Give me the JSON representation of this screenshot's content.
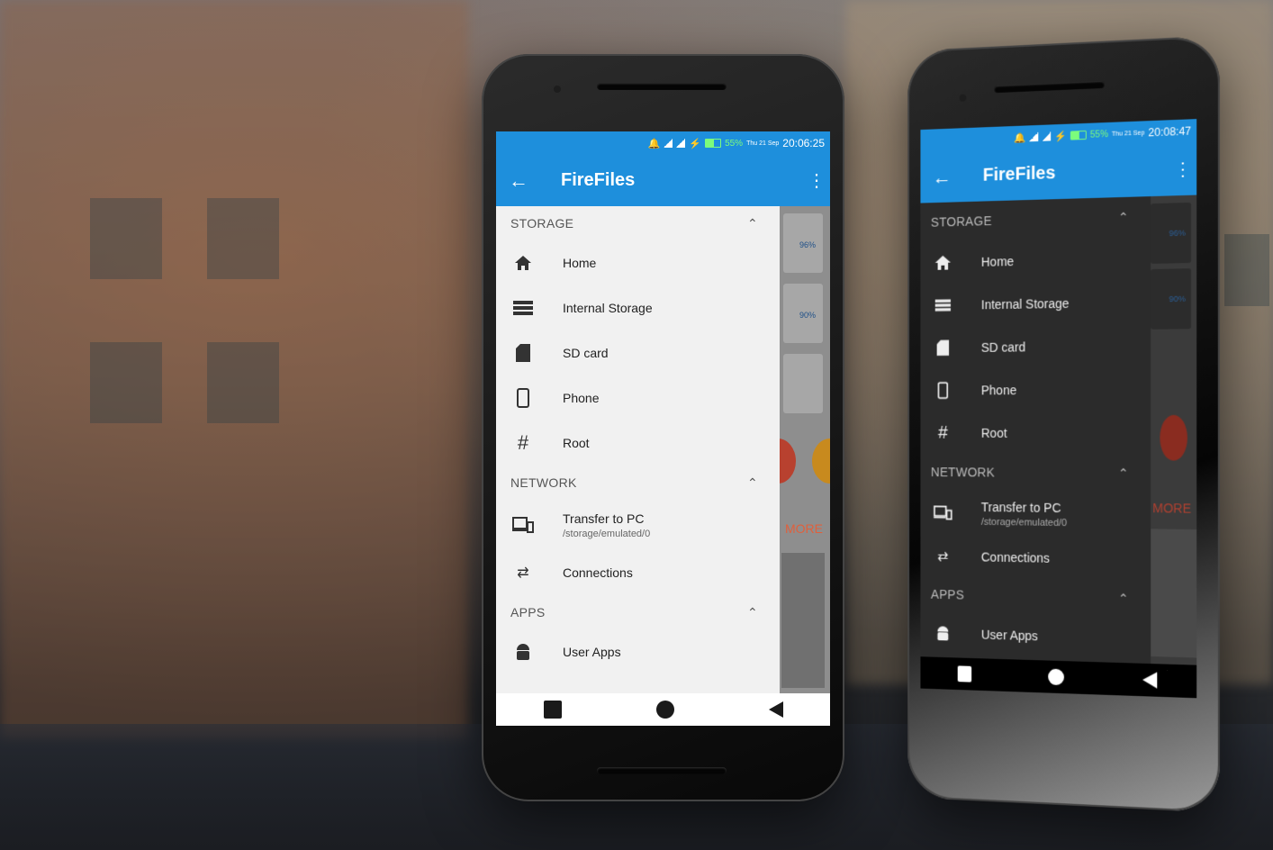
{
  "phones": [
    {
      "theme": "light",
      "status": {
        "battery": "55%",
        "date": "Thu 21 Sep",
        "time": "20:06:25"
      },
      "app_title": "FireFiles",
      "underlay": {
        "card1_pct": "96%",
        "card2_pct": "90%",
        "more_label": "MORE"
      },
      "sections": [
        {
          "title": "STORAGE",
          "items": [
            {
              "icon": "home-icon",
              "label": "Home"
            },
            {
              "icon": "storage-icon",
              "label": "Internal Storage"
            },
            {
              "icon": "sd-card-icon",
              "label": "SD card"
            },
            {
              "icon": "phone-icon",
              "label": "Phone"
            },
            {
              "icon": "hash-icon",
              "label": "Root"
            }
          ]
        },
        {
          "title": "NETWORK",
          "items": [
            {
              "icon": "devices-icon",
              "label": "Transfer to PC",
              "sub": "/storage/emulated/0"
            },
            {
              "icon": "connections-icon",
              "label": "Connections"
            }
          ]
        },
        {
          "title": "APPS",
          "items": [
            {
              "icon": "android-icon",
              "label": "User Apps"
            }
          ]
        }
      ]
    },
    {
      "theme": "dark",
      "status": {
        "battery": "55%",
        "date": "Thu 21 Sep",
        "time": "20:08:47"
      },
      "app_title": "FireFiles",
      "underlay": {
        "card1_pct": "96%",
        "card2_pct": "90%",
        "more_label": "MORE"
      },
      "sections": [
        {
          "title": "STORAGE",
          "items": [
            {
              "icon": "home-icon",
              "label": "Home"
            },
            {
              "icon": "storage-icon",
              "label": "Internal Storage"
            },
            {
              "icon": "sd-card-icon",
              "label": "SD card"
            },
            {
              "icon": "phone-icon",
              "label": "Phone"
            },
            {
              "icon": "hash-icon",
              "label": "Root"
            }
          ]
        },
        {
          "title": "NETWORK",
          "items": [
            {
              "icon": "devices-icon",
              "label": "Transfer to PC",
              "sub": "/storage/emulated/0"
            },
            {
              "icon": "connections-icon",
              "label": "Connections"
            }
          ]
        },
        {
          "title": "APPS",
          "items": [
            {
              "icon": "android-icon",
              "label": "User Apps"
            }
          ]
        }
      ]
    }
  ]
}
